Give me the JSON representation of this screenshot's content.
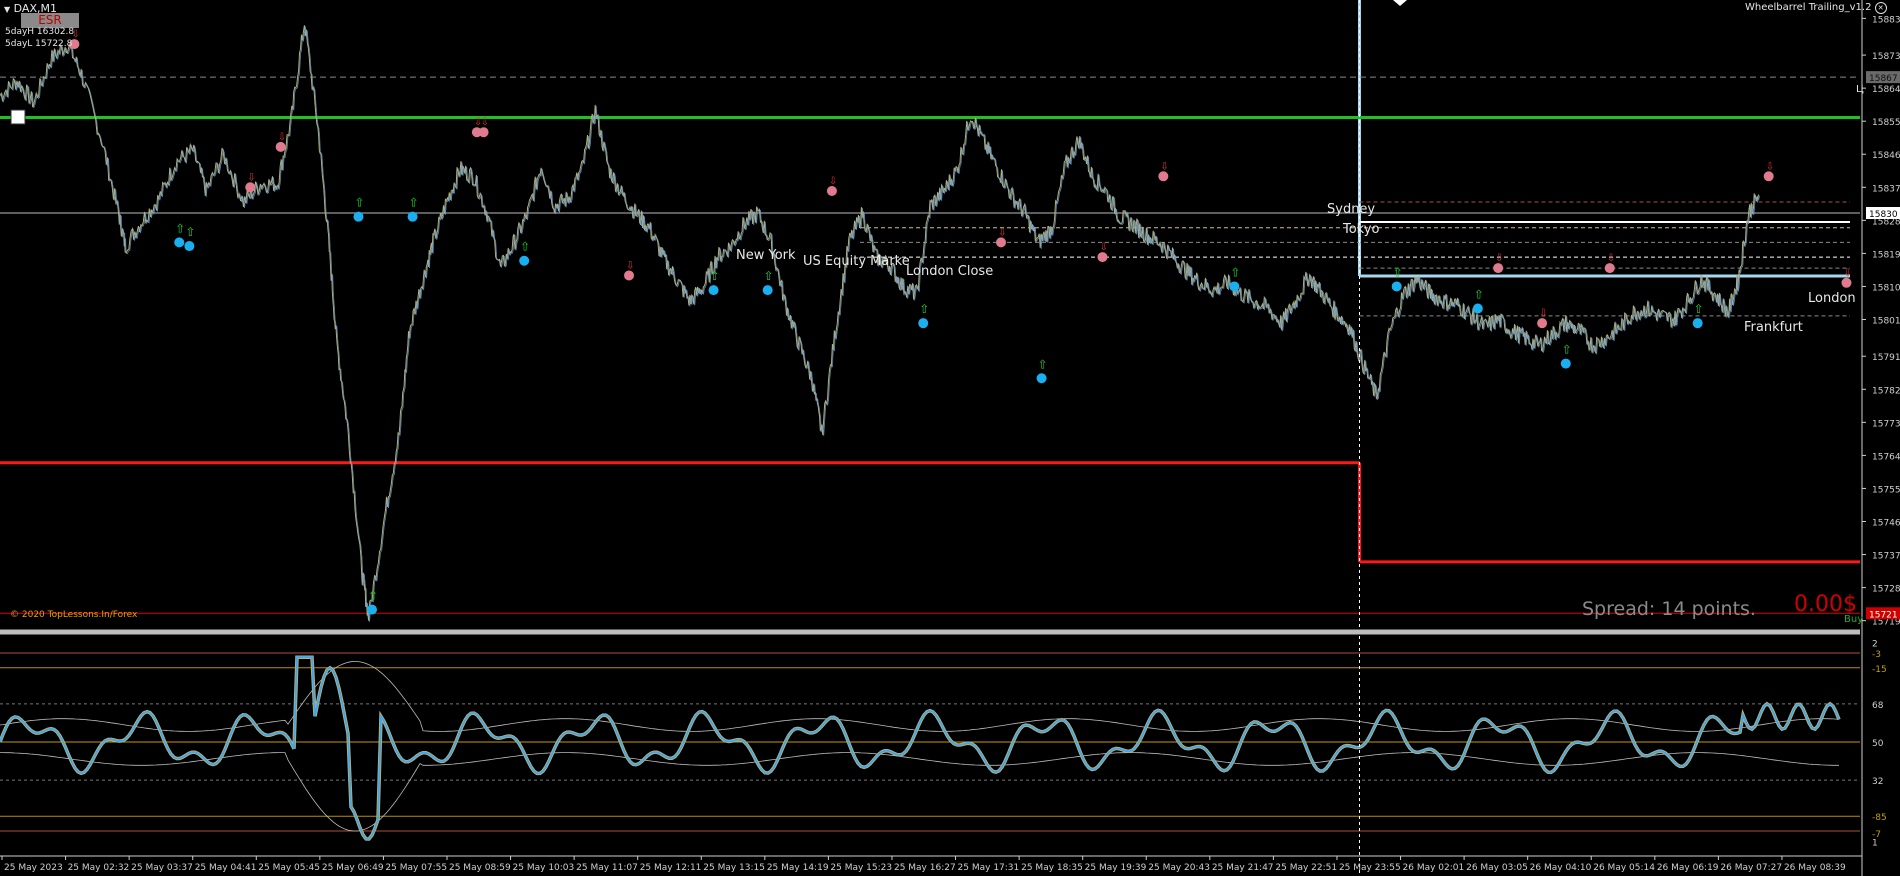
{
  "header": {
    "symbol": "DAX,M1",
    "esr_badge": "ESR",
    "five_day_high": "5dayH 16302.8",
    "five_day_low": "5dayL 15722.8",
    "indicator_name": "Wheelbarrel Trailing_v1.2"
  },
  "price_axis": {
    "ticks": [
      "15883",
      "15873",
      "15864",
      "15855",
      "15846",
      "15837",
      "15828",
      "15819",
      "15810",
      "15801",
      "15791",
      "15782",
      "15773",
      "15764",
      "15755",
      "15746",
      "15737",
      "15728",
      "15719"
    ],
    "highlight_upper": "15867",
    "current_price": "15830",
    "highlight_lower": "15721",
    "edge_label": "Ц"
  },
  "sessions": {
    "new_york": "New York",
    "us_equity": "US Equity Marke",
    "london_close": "London Close",
    "sydney": "Sydney",
    "tokyo": "Tokyo",
    "london": "London",
    "frankfurt": "Frankfurt"
  },
  "footer_info": {
    "copyright": "© 2020 TopLessons.In/Forex",
    "spread": "Spread: 14 points.",
    "profit": "0.00$",
    "side": "Buy"
  },
  "oscillator_axis": {
    "labels": [
      "2",
      "-3",
      "-15",
      "68",
      "50",
      "32",
      "-85",
      "-7",
      "1"
    ]
  },
  "time_axis": {
    "labels": [
      "25 May 2023",
      "25 May 02:32",
      "25 May 03:37",
      "25 May 04:41",
      "25 May 05:45",
      "25 May 06:49",
      "25 May 07:55",
      "25 May 08:59",
      "25 May 10:03",
      "25 May 11:07",
      "25 May 12:11",
      "25 May 13:15",
      "25 May 14:19",
      "25 May 15:23",
      "25 May 16:27",
      "25 May 17:31",
      "25 May 18:35",
      "25 May 19:39",
      "25 May 20:43",
      "25 May 21:47",
      "25 May 22:51",
      "25 May 23:55",
      "26 May 02:01",
      "26 May 03:05",
      "26 May 04:10",
      "26 May 05:14",
      "26 May 06:19",
      "26 May 07:27",
      "26 May 08:39"
    ]
  },
  "chart_data": {
    "type": "line",
    "symbol": "DAX",
    "timeframe": "M1",
    "ylim": [
      15717,
      15888
    ],
    "price_series": [
      [
        0,
        15862
      ],
      [
        0.5,
        15866
      ],
      [
        1,
        15860
      ],
      [
        1.5,
        15872
      ],
      [
        2,
        15876
      ],
      [
        2.4,
        15868
      ],
      [
        3,
        15850
      ],
      [
        3.5,
        15830
      ],
      [
        3.7,
        15821
      ],
      [
        4.2,
        15828
      ],
      [
        4.7,
        15834
      ],
      [
        5.2,
        15844
      ],
      [
        5.7,
        15847
      ],
      [
        6.1,
        15836
      ],
      [
        6.6,
        15846
      ],
      [
        7.2,
        15833
      ],
      [
        7.7,
        15838
      ],
      [
        8.2,
        15838
      ],
      [
        8.6,
        15855
      ],
      [
        9,
        15882
      ],
      [
        9.4,
        15853
      ],
      [
        9.7,
        15824
      ],
      [
        9.95,
        15795
      ],
      [
        10.3,
        15770
      ],
      [
        10.7,
        15732
      ],
      [
        10.9,
        15720
      ],
      [
        11.4,
        15749
      ],
      [
        11.8,
        15770
      ],
      [
        12.1,
        15798
      ],
      [
        12.5,
        15812
      ],
      [
        12.8,
        15822
      ],
      [
        13.2,
        15833
      ],
      [
        13.6,
        15842
      ],
      [
        14,
        15840
      ],
      [
        14.4,
        15830
      ],
      [
        14.8,
        15815
      ],
      [
        15.2,
        15822
      ],
      [
        15.6,
        15830
      ],
      [
        16,
        15843
      ],
      [
        16.4,
        15832
      ],
      [
        16.8,
        15834
      ],
      [
        17.2,
        15842
      ],
      [
        17.6,
        15858
      ],
      [
        18,
        15842
      ],
      [
        18.4,
        15835
      ],
      [
        18.8,
        15830
      ],
      [
        19.2,
        15826
      ],
      [
        19.6,
        15818
      ],
      [
        20,
        15812
      ],
      [
        20.4,
        15806
      ],
      [
        20.8,
        15810
      ],
      [
        21.2,
        15818
      ],
      [
        21.6,
        15821
      ],
      [
        22,
        15827
      ],
      [
        22.4,
        15830
      ],
      [
        22.8,
        15822
      ],
      [
        23.2,
        15806
      ],
      [
        23.6,
        15795
      ],
      [
        24,
        15785
      ],
      [
        24.3,
        15770
      ],
      [
        24.7,
        15798
      ],
      [
        25.1,
        15822
      ],
      [
        25.5,
        15830
      ],
      [
        25.9,
        15818
      ],
      [
        26.3,
        15816
      ],
      [
        26.7,
        15810
      ],
      [
        27.1,
        15808
      ],
      [
        27.5,
        15832
      ],
      [
        27.9,
        15836
      ],
      [
        28.3,
        15842
      ],
      [
        28.7,
        15857
      ],
      [
        29.1,
        15849
      ],
      [
        29.5,
        15842
      ],
      [
        29.9,
        15835
      ],
      [
        30.3,
        15830
      ],
      [
        30.7,
        15822
      ],
      [
        31.1,
        15826
      ],
      [
        31.5,
        15843
      ],
      [
        31.9,
        15850
      ],
      [
        32.3,
        15840
      ],
      [
        32.7,
        15836
      ],
      [
        33.1,
        15829
      ],
      [
        33.5,
        15827
      ],
      [
        33.9,
        15824
      ],
      [
        34.3,
        15822
      ],
      [
        34.7,
        15818
      ],
      [
        35.1,
        15814
      ],
      [
        35.5,
        15811
      ],
      [
        35.9,
        15809
      ],
      [
        36.3,
        15811
      ],
      [
        36.7,
        15808
      ],
      [
        37.1,
        15806
      ],
      [
        37.5,
        15804
      ],
      [
        37.9,
        15800
      ],
      [
        38.3,
        15806
      ],
      [
        38.7,
        15813
      ],
      [
        39.1,
        15808
      ],
      [
        39.5,
        15803
      ],
      [
        39.9,
        15799
      ],
      [
        40.3,
        15789
      ],
      [
        40.7,
        15780
      ],
      [
        41.1,
        15798
      ],
      [
        41.5,
        15808
      ],
      [
        41.9,
        15812
      ],
      [
        42.3,
        15808
      ],
      [
        42.7,
        15806
      ],
      [
        43.1,
        15805
      ],
      [
        43.5,
        15802
      ],
      [
        43.9,
        15799
      ],
      [
        44.3,
        15801
      ],
      [
        44.7,
        15798
      ],
      [
        45.1,
        15796
      ],
      [
        45.5,
        15794
      ],
      [
        45.9,
        15797
      ],
      [
        46.3,
        15800
      ],
      [
        46.7,
        15798
      ],
      [
        47.1,
        15794
      ],
      [
        47.5,
        15796
      ],
      [
        47.9,
        15799
      ],
      [
        48.3,
        15803
      ],
      [
        48.7,
        15804
      ],
      [
        49.1,
        15802
      ],
      [
        49.5,
        15801
      ],
      [
        49.9,
        15806
      ],
      [
        50.3,
        15812
      ],
      [
        50.7,
        15808
      ],
      [
        51.1,
        15803
      ],
      [
        51.4,
        15812
      ],
      [
        51.7,
        15830
      ],
      [
        52,
        15835
      ]
    ],
    "horizontal_levels": [
      {
        "name": "resistance-green",
        "value": 15856,
        "color": "#22c022",
        "from": 0,
        "to": 55
      },
      {
        "name": "support-red",
        "value": 15762,
        "color": "#ff1818",
        "from": 0,
        "to": 40.2
      },
      {
        "name": "support-red-stepped",
        "value": 15735,
        "color": "#ff1818",
        "from": 40.2,
        "to": 55
      },
      {
        "name": "five-day-low",
        "value": 15721,
        "color": "#dd0000",
        "from": 0,
        "to": 55
      },
      {
        "name": "current-price",
        "value": 15830,
        "color": "#bbbbbb",
        "from": 0,
        "to": 55
      },
      {
        "name": "dashed-upper",
        "value": 15867,
        "color": "#8a8a8a",
        "from": 0,
        "to": 55
      }
    ],
    "vertical_markers": [
      {
        "name": "session-start",
        "x": 40.2,
        "color": "#a8d8f0"
      },
      {
        "name": "day-separator",
        "x": 40.2,
        "color": "#ffffff"
      }
    ],
    "oscillator": {
      "ylim": [
        0,
        100
      ],
      "levels": [
        50,
        68,
        32,
        92,
        8
      ],
      "main_color": "#35a7ff"
    },
    "buy_signals": [
      [
        5.3,
        15822
      ],
      [
        11,
        15722
      ],
      [
        5.6,
        15821
      ],
      [
        10.6,
        15829
      ],
      [
        12.2,
        15829
      ],
      [
        15.5,
        15817
      ],
      [
        21.1,
        15809
      ],
      [
        22.7,
        15809
      ],
      [
        27.3,
        15800
      ],
      [
        30.8,
        15785
      ],
      [
        36.5,
        15810
      ],
      [
        41.3,
        15810
      ],
      [
        43.7,
        15804
      ],
      [
        46.3,
        15789
      ],
      [
        50.2,
        15800
      ]
    ],
    "sell_signals": [
      [
        2.2,
        15876
      ],
      [
        7.4,
        15837
      ],
      [
        8.3,
        15848
      ],
      [
        14.1,
        15852
      ],
      [
        14.3,
        15852
      ],
      [
        18.6,
        15813
      ],
      [
        24.6,
        15836
      ],
      [
        29.6,
        15822
      ],
      [
        32.6,
        15818
      ],
      [
        34.4,
        15840
      ],
      [
        44.3,
        15815
      ],
      [
        45.6,
        15800
      ],
      [
        47.6,
        15815
      ],
      [
        52.3,
        15840
      ],
      [
        54.6,
        15811
      ]
    ]
  }
}
